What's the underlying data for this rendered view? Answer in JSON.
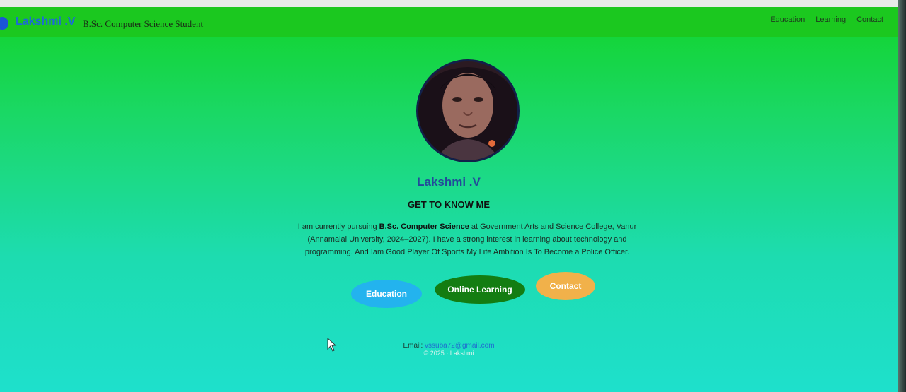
{
  "header": {
    "brand_name": "Lakshmi .V",
    "brand_subtitle": "B.Sc. Computer Science Student",
    "nav": [
      "Education",
      "Learning",
      "Contact"
    ]
  },
  "profile": {
    "name": "Lakshmi .V",
    "section_title": "GET TO KNOW ME",
    "about_part1": "I am currently pursuing ",
    "about_bold": "B.Sc. Computer Science",
    "about_part2": " at Government Arts and Science College, Vanur (Annamalai University, 2024–2027). I have a strong interest in learning about technology and programming. And Iam Good Player Of Sports My Life Ambition Is To Become a Police Officer."
  },
  "buttons": {
    "education": "Education",
    "learning": "Online Learning",
    "contact": "Contact"
  },
  "footer": {
    "email_label": "Email: ",
    "email": "vssuba72@gmail.com",
    "copyright": "© 2025 · Lakshmi"
  },
  "colors": {
    "nav_bg": "#1bc81f",
    "education_btn": "#23b3ee",
    "learning_btn": "#137d12",
    "contact_btn": "#f1b14a",
    "name": "#234a9a"
  }
}
